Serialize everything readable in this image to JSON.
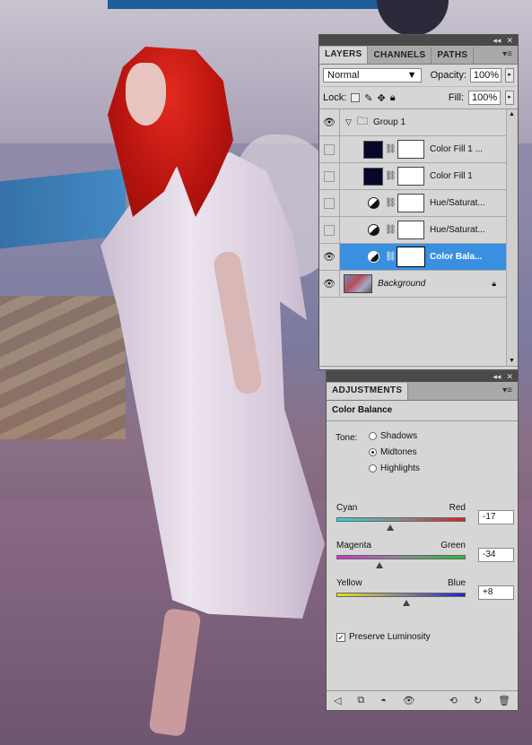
{
  "layers_panel": {
    "tabs": [
      "LAYERS",
      "CHANNELS",
      "PATHS"
    ],
    "blend_mode": "Normal",
    "opacity_label": "Opacity:",
    "opacity_value": "100%",
    "lock_label": "Lock:",
    "fill_label": "Fill:",
    "fill_value": "100%",
    "layers": [
      {
        "name": "Group 1",
        "visible": true
      },
      {
        "name": "Color Fill 1 ...",
        "visible": false
      },
      {
        "name": "Color Fill 1",
        "visible": false
      },
      {
        "name": "Hue/Saturat...",
        "visible": false
      },
      {
        "name": "Hue/Saturat...",
        "visible": false
      },
      {
        "name": "Color Bala...",
        "visible": true,
        "selected": true
      },
      {
        "name": "Background",
        "visible": true
      }
    ]
  },
  "adjustments_panel": {
    "tab": "ADJUSTMENTS",
    "title": "Color Balance",
    "tone_label": "Tone:",
    "tones": [
      "Shadows",
      "Midtones",
      "Highlights"
    ],
    "selected_tone": "Midtones",
    "sliders": [
      {
        "left": "Cyan",
        "right": "Red",
        "value": "-17",
        "amount": -17
      },
      {
        "left": "Magenta",
        "right": "Green",
        "value": "-34",
        "amount": -34
      },
      {
        "left": "Yellow",
        "right": "Blue",
        "value": "+8",
        "amount": 8
      }
    ],
    "preserve_luminosity_label": "Preserve Luminosity",
    "preserve_luminosity": true
  },
  "colors": {
    "selection": "#3a8fe0",
    "panel_bg": "#d6d6d6",
    "color_fill_swatch": "#07072a"
  }
}
